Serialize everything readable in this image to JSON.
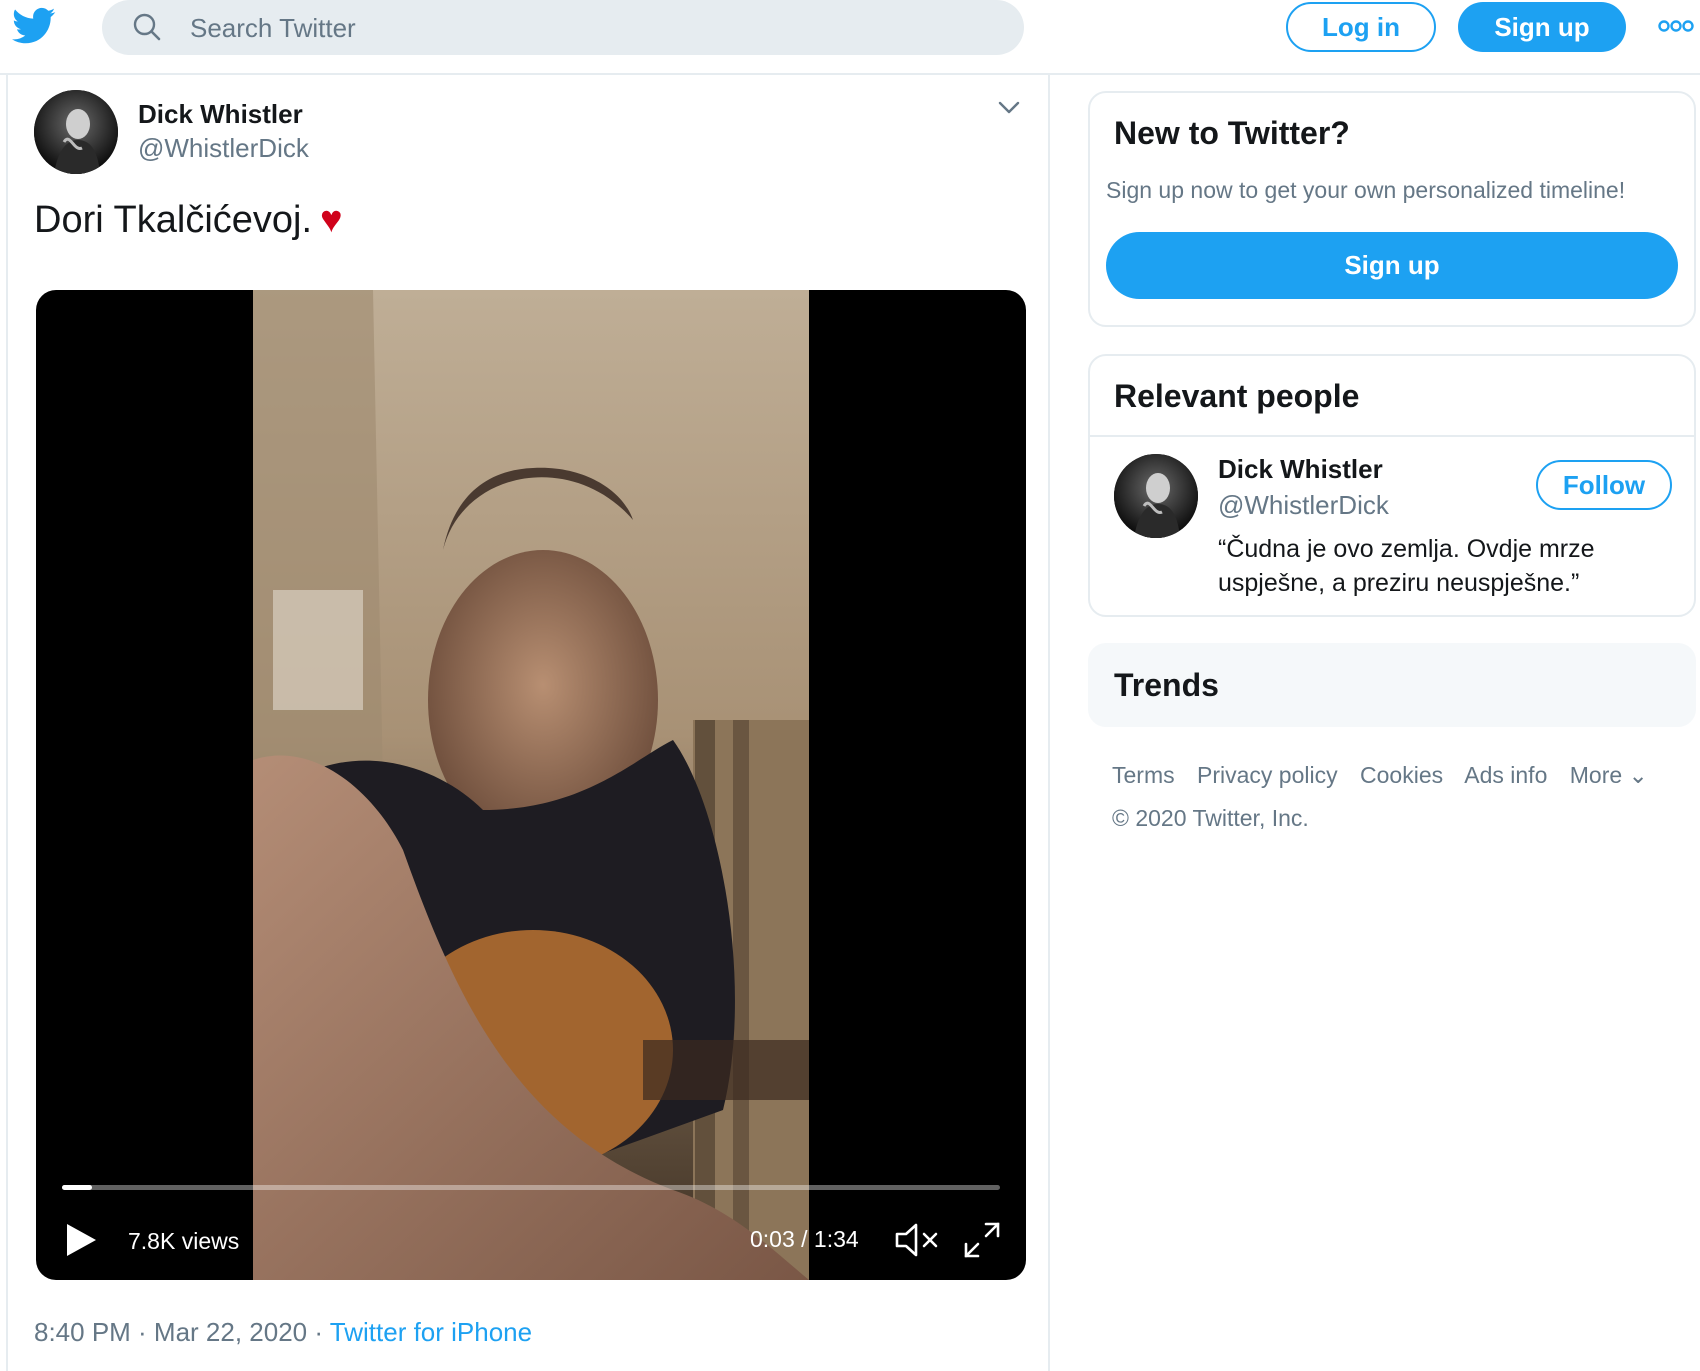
{
  "topbar": {
    "search_placeholder": "Search Twitter",
    "login_label": "Log in",
    "signup_label": "Sign up"
  },
  "tweet": {
    "name": "Dick Whistler",
    "handle": "@WhistlerDick",
    "text": "Dori Tkalčićevoj.",
    "heart": "♥",
    "video": {
      "views": "7.8K views",
      "time": "0:03 / 1:34",
      "progress": 0.032
    },
    "timestamp": "8:40 PM · Mar 22, 2020 · ",
    "source": "Twitter for iPhone"
  },
  "sidebar": {
    "new_to_twitter": {
      "title": "New to Twitter?",
      "subtitle": "Sign up now to get your own personalized timeline!",
      "button": "Sign up"
    },
    "relevant_people": {
      "title": "Relevant people",
      "person": {
        "name": "Dick Whistler",
        "handle": "@WhistlerDick",
        "bio": "“Čudna je ovo zemlja. Ovdje mrze uspješne, a preziru neuspješne.”",
        "follow_label": "Follow"
      }
    },
    "trends": {
      "title": "Trends"
    },
    "footer": {
      "links": [
        "Terms",
        "Privacy policy",
        "Cookies",
        "Ads info",
        "More ⌄"
      ],
      "copyright": "© 2020 Twitter, Inc."
    }
  },
  "colors": {
    "accent": "#1da1f2",
    "border": "#e6ecf0",
    "muted_text": "#657786",
    "heart": "#d0021b"
  }
}
